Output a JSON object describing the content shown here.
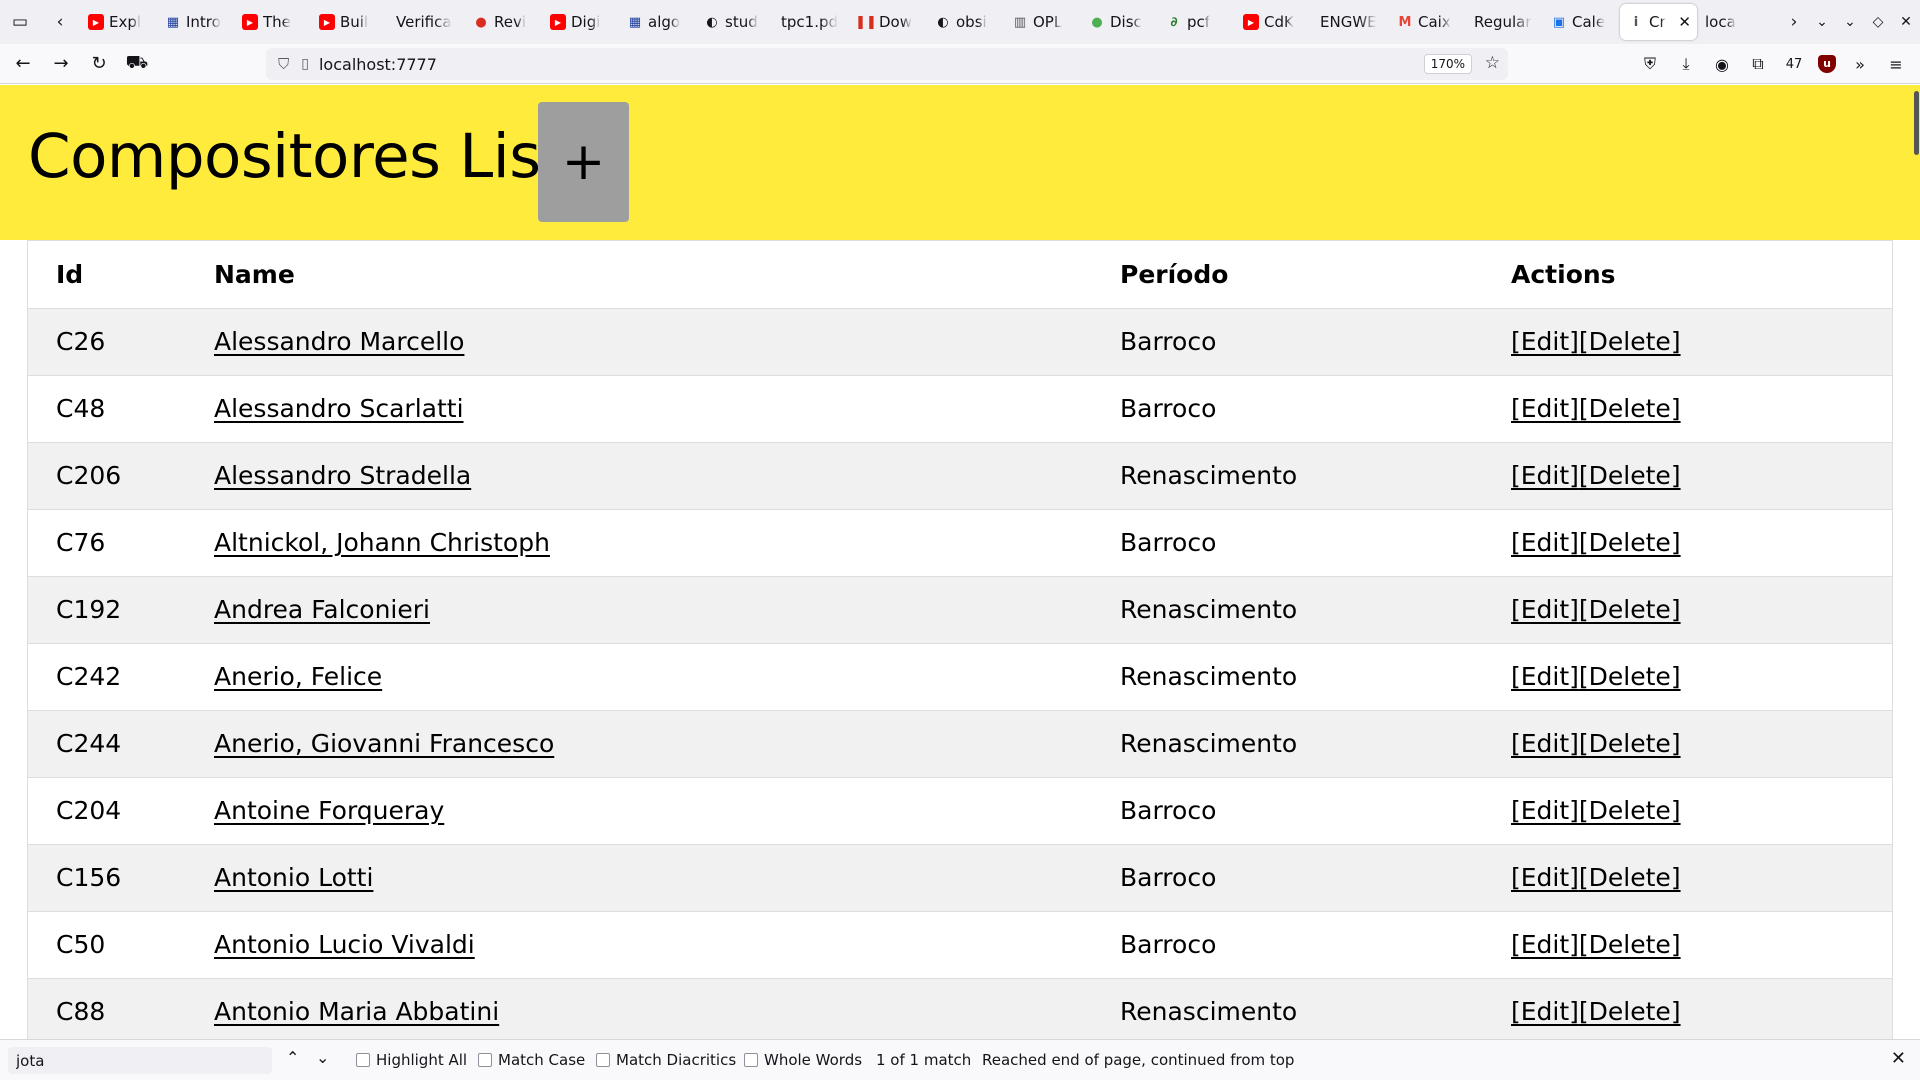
{
  "browser": {
    "tabs": [
      {
        "label": "Expl",
        "icon": "youtube-icon",
        "color": "#ff0000"
      },
      {
        "label": "Intro",
        "icon": "grid-icon",
        "color": "#1a3a9c"
      },
      {
        "label": "The",
        "icon": "youtube-icon",
        "color": "#ff0000"
      },
      {
        "label": "Buil",
        "icon": "youtube-icon",
        "color": "#ff0000"
      },
      {
        "label": "Verifica",
        "icon": "",
        "color": ""
      },
      {
        "label": "Revi",
        "icon": "record-icon",
        "color": "#d92d20"
      },
      {
        "label": "Digi",
        "icon": "youtube-icon",
        "color": "#ff0000"
      },
      {
        "label": "algo",
        "icon": "grid-icon",
        "color": "#1a3a9c"
      },
      {
        "label": "stud",
        "icon": "github-icon",
        "color": "#15141a"
      },
      {
        "label": "tpc1.pd",
        "icon": "",
        "color": ""
      },
      {
        "label": "Dow",
        "icon": "pause-icon",
        "color": "#d92d20"
      },
      {
        "label": "obsi",
        "icon": "github-icon",
        "color": "#15141a"
      },
      {
        "label": "OPL",
        "icon": "building-icon",
        "color": "#555555"
      },
      {
        "label": "Disc",
        "icon": "dot-icon",
        "color": "#4caf50"
      },
      {
        "label": "pcf",
        "icon": "link-icon",
        "color": "#2e7d32"
      },
      {
        "label": "CdK",
        "icon": "youtube-icon",
        "color": "#ff0000"
      },
      {
        "label": "ENGWE",
        "icon": "",
        "color": ""
      },
      {
        "label": "Caix",
        "icon": "gmail-icon",
        "color": "#ea4335"
      },
      {
        "label": "Regular",
        "icon": "",
        "color": ""
      },
      {
        "label": "Cale",
        "icon": "calendar-icon",
        "color": "#1a73e8"
      },
      {
        "label": "Cr",
        "icon": "info-icon",
        "color": "#555555",
        "active": true
      },
      {
        "label": "loca",
        "icon": "",
        "color": ""
      }
    ],
    "url": "localhost:7777",
    "zoom": "170%",
    "extensions_count": "47"
  },
  "page": {
    "title": "Compositores List",
    "add_button": "+",
    "header_color": "#ffeb3b",
    "button_color": "#9e9e9e",
    "table": {
      "columns": [
        "Id",
        "Name",
        "Período",
        "Actions"
      ],
      "rows": [
        {
          "id": "C26",
          "name": "Alessandro Marcello",
          "periodo": "Barroco"
        },
        {
          "id": "C48",
          "name": "Alessandro Scarlatti",
          "periodo": "Barroco"
        },
        {
          "id": "C206",
          "name": "Alessandro Stradella",
          "periodo": "Renascimento"
        },
        {
          "id": "C76",
          "name": "Altnickol, Johann Christoph",
          "periodo": "Barroco"
        },
        {
          "id": "C192",
          "name": "Andrea Falconieri",
          "periodo": "Renascimento"
        },
        {
          "id": "C242",
          "name": "Anerio, Felice",
          "periodo": "Renascimento"
        },
        {
          "id": "C244",
          "name": "Anerio, Giovanni Francesco",
          "periodo": "Renascimento"
        },
        {
          "id": "C204",
          "name": "Antoine Forqueray",
          "periodo": "Barroco"
        },
        {
          "id": "C156",
          "name": "Antonio Lotti",
          "periodo": "Barroco"
        },
        {
          "id": "C50",
          "name": "Antonio Lucio Vivaldi",
          "periodo": "Barroco"
        },
        {
          "id": "C88",
          "name": "Antonio Maria Abbatini",
          "periodo": "Renascimento"
        }
      ],
      "edit_label": "[Edit]",
      "delete_label": "[Delete]"
    }
  },
  "findbar": {
    "query": "jota",
    "options": [
      {
        "label": "Highlight All",
        "checked": false
      },
      {
        "label": "Match Case",
        "checked": false
      },
      {
        "label": "Match Diacritics",
        "checked": false
      },
      {
        "label": "Whole Words",
        "checked": false
      }
    ],
    "match_count": "1 of 1 match",
    "status": "Reached end of page, continued from top"
  }
}
